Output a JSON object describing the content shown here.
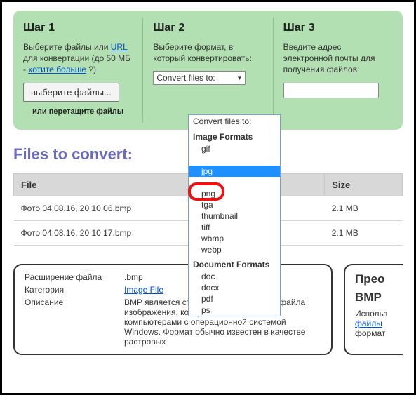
{
  "steps": {
    "s1": {
      "title": "Шаг 1",
      "desc_a": "Выберите файлы или ",
      "url_link": "URL",
      "desc_b": " для конвертации (до 50 МБ - ",
      "want_more": "хотите больше",
      "desc_c": " ?)",
      "choose_btn": "выберите файлы...",
      "drag": "или перетащите файлы"
    },
    "s2": {
      "title": "Шаг 2",
      "desc": "Выберите формат, в который конвертировать:",
      "select_label": "Convert files to:"
    },
    "s3": {
      "title": "Шаг 3",
      "desc": "Введите адрес электронной почты для получения файлов:"
    }
  },
  "files_header": "Files to convert:",
  "cols": {
    "file": "File",
    "size": "Size"
  },
  "rows": [
    {
      "name": "Фото 04.08.16, 20 10 06.bmp",
      "size": "2.1 MB"
    },
    {
      "name": "Фото 04.08.16, 20 10 17.bmp",
      "size": "2.1 MB"
    }
  ],
  "info": {
    "ext_label": "Расширение файла",
    "ext_val": ".bmp",
    "cat_label": "Категория",
    "cat_link": "Image File",
    "desc_label": "Описание",
    "desc_val": "BMP является стандартным форматом файла изображения, который использовался компьютерами с операционной системой Windows. Формат обычно известен в качестве растровых"
  },
  "right": {
    "title_a": "Прео",
    "title_b": "BMP",
    "p1": "Использ",
    "link": "файлы",
    "p2": "формат"
  },
  "dropdown": {
    "head": "Convert files to:",
    "group1": "Image Formats",
    "items1_a": [
      "gif"
    ],
    "sel": "jpg",
    "items1_b": [
      "png",
      "tga",
      "thumbnail",
      "tiff",
      "wbmp",
      "webp"
    ],
    "group2": "Document Formats",
    "items2": [
      "doc",
      "docx",
      "pdf",
      "ps"
    ]
  }
}
